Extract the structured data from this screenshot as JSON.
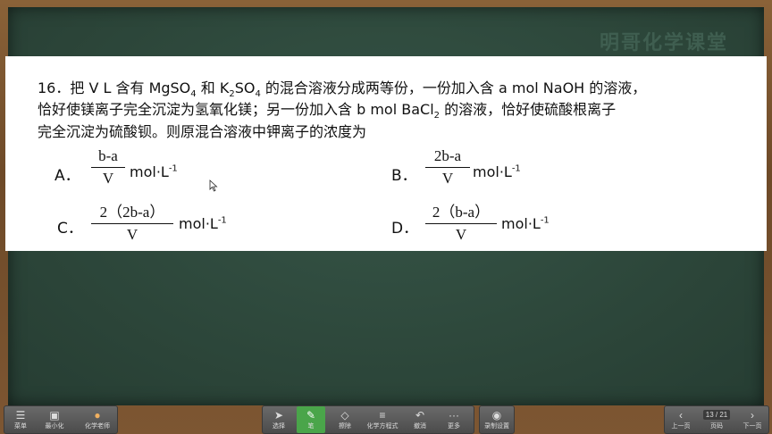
{
  "watermark": "明哥化学课堂",
  "question": {
    "line1_a": "16．把 V L 含有 MgSO",
    "line1_sub1": "4",
    "line1_b": " 和 K",
    "line1_sub2": "2",
    "line1_c": "SO",
    "line1_sub3": "4",
    "line1_d": " 的混合溶液分成两等份，一份加入含 a mol NaOH 的溶液，",
    "line2": "恰好使镁离子完全沉淀为氢氧化镁；另一份加入含 b mol BaCl",
    "line2_sub": "2",
    "line2_b": " 的溶液，恰好使硫酸根离子",
    "line3": "完全沉淀为硫酸钡。则原混合溶液中钾离子的浓度为"
  },
  "options": {
    "A": {
      "letter": "A．",
      "num": "b-a",
      "den": "V",
      "unit": "mol·L",
      "exp": "-1"
    },
    "B": {
      "letter": "B．",
      "num": "2b-a",
      "den": "V",
      "unit": "mol·L",
      "exp": "-1"
    },
    "C": {
      "letter": "C．",
      "num": "2（2b-a）",
      "den": "V",
      "unit": "mol·L",
      "exp": "-1"
    },
    "D": {
      "letter": "D．",
      "num": "2（b-a）",
      "den": "V",
      "unit": "mol·L",
      "exp": "-1"
    }
  },
  "toolbar": {
    "menu": "菜单",
    "minimize": "最小化",
    "teacher": "化学老师",
    "select": "选择",
    "pen": "笔",
    "eraser": "擦除",
    "chem_equation": "化学方程式",
    "undo": "撤消",
    "more": "更多",
    "record": "录制设置",
    "prev": "上一页",
    "page": "13 / 21",
    "page_label": "页码",
    "next": "下一页"
  },
  "icons": {
    "menu": "hamburger-icon",
    "minimize": "minimize-icon",
    "teacher": "avatar-icon",
    "select": "cursor-icon",
    "pen": "pen-icon",
    "eraser": "eraser-icon",
    "chem": "chem-equation-icon",
    "undo": "undo-icon",
    "more": "ellipsis-icon",
    "record": "record-icon",
    "prev": "chevron-left-icon",
    "next": "chevron-right-icon"
  },
  "colors": {
    "board": "#2f4a3e",
    "frame": "#7a5430",
    "active_tool": "#4aa54a"
  }
}
